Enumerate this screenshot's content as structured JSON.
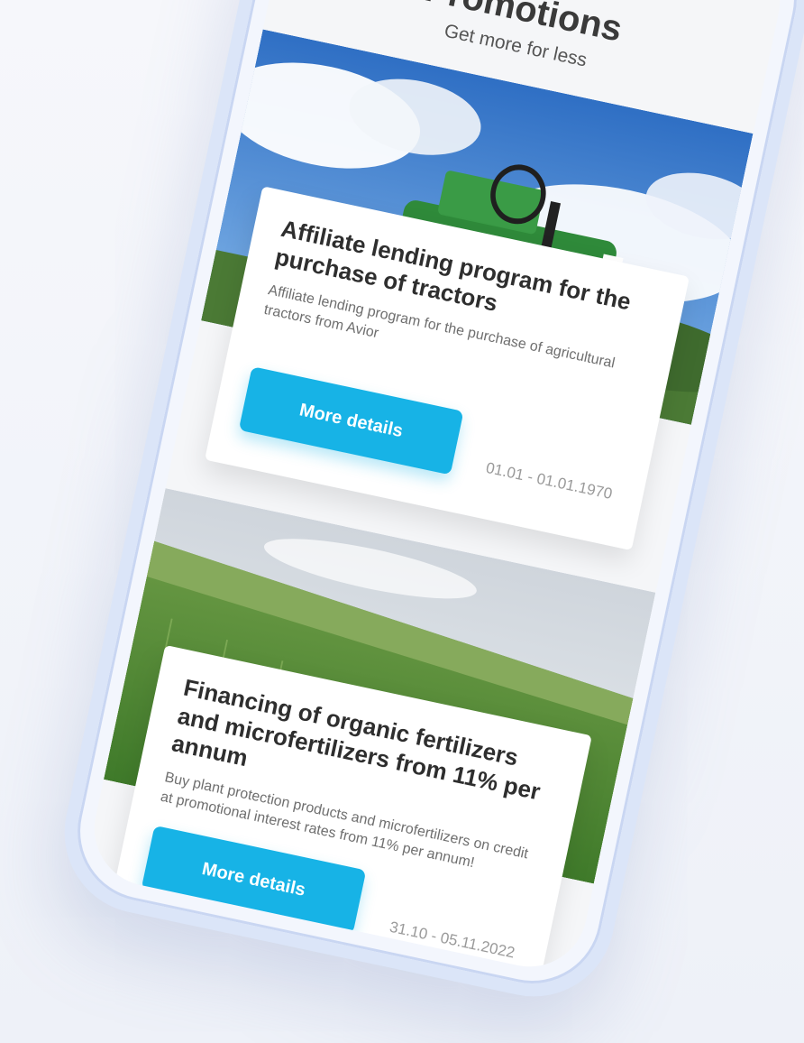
{
  "header": {
    "title": "Promotions",
    "subtitle": "Get more for less"
  },
  "promos": [
    {
      "image": "tractor-photo",
      "title": "Affiliate lending program for the purchase of tractors",
      "description": "Affiliate lending program for the purchase of agricultural tractors from Avior",
      "button_label": "More details",
      "date_range": "01.01 - 01.01.1970"
    },
    {
      "image": "wheat-field-photo",
      "title": "Financing of organic fertilizers and microfertilizers from 11% per annum",
      "description": "Buy plant protection products and microfertilizers on credit at promotional interest rates from 11% per annum!",
      "button_label": "More details",
      "date_range": "31.10 - 05.11.2022"
    }
  ],
  "colors": {
    "accent": "#17b3e6",
    "phone_frame": "#dbe5f8"
  }
}
